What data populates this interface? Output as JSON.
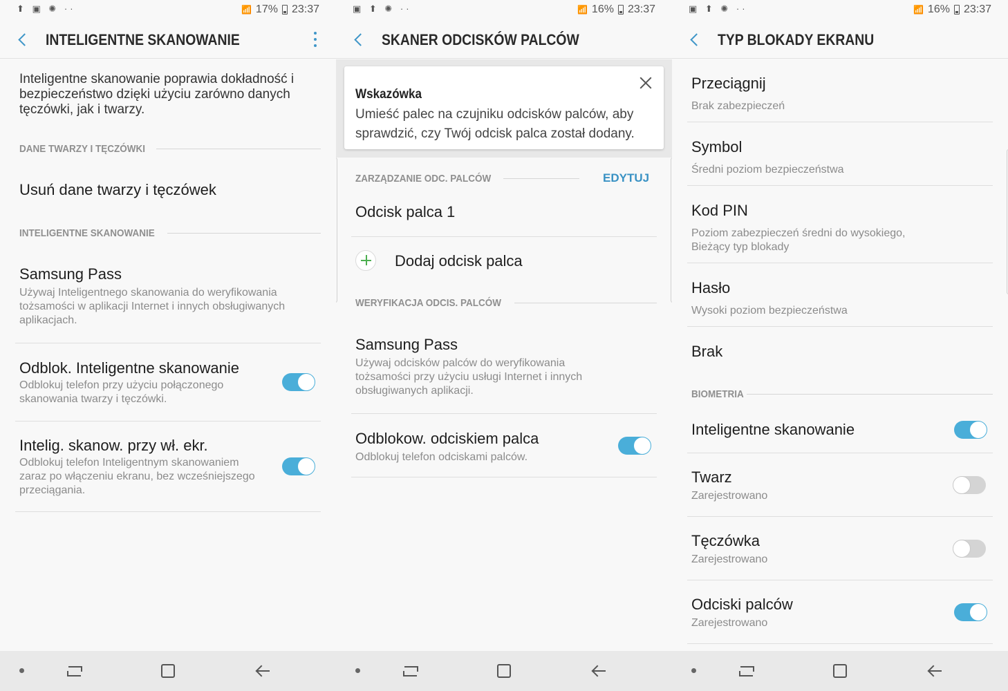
{
  "colors": {
    "accent": "#4aaed9",
    "link": "#3a92c4",
    "plus": "#4caf50"
  },
  "panel1": {
    "status": {
      "icons": "⬆ ▣ ✺ ··",
      "battery": "17%",
      "time": "23:37"
    },
    "title": "INTELIGENTNE SKANOWANIE",
    "description": "Inteligentne skanowanie poprawia dokładność i bezpieczeństwo dzięki użyciu zarówno danych tęczówki, jak i twarzy.",
    "section1": "DANE TWARZY I TĘCZÓWKI",
    "remove_data": "Usuń dane twarzy i tęczówek",
    "section2": "INTELIGENTNE SKANOWANIE",
    "samsung_pass": {
      "title": "Samsung Pass",
      "subtitle": "Używaj Inteligentnego skanowania do weryfikowania tożsamości w aplikacji Internet i innych obsługiwanych aplikacjach."
    },
    "unlock": {
      "title": "Odblok. Inteligentne skanowanie",
      "subtitle": "Odblokuj telefon przy użyciu połączonego skanowania twarzy i tęczówki.",
      "on": true
    },
    "screen_on": {
      "title": "Intelig. skanow. przy wł. ekr.",
      "subtitle": "Odblokuj telefon Inteligentnym skanowaniem zaraz po włączeniu ekranu, bez wcześniejszego przeciągania.",
      "on": true
    }
  },
  "panel2": {
    "status": {
      "icons": "▣ ⬆ ✺ ··",
      "battery": "16%",
      "time": "23:37"
    },
    "title": "SKANER ODCISKÓW PALCÓW",
    "tip": {
      "title": "Wskazówka",
      "body": "Umieść palec na czujniku odcisków palców, aby sprawdzić, czy Twój odcisk palca został dodany."
    },
    "section1": "ZARZĄDZANIE ODC. PALCÓW",
    "edit": "EDYTUJ",
    "fingerprint1": "Odcisk palca 1",
    "add_fingerprint": "Dodaj odcisk palca",
    "section2": "WERYFIKACJA ODCIS. PALCÓW",
    "samsung_pass": {
      "title": "Samsung Pass",
      "subtitle": "Używaj odcisków palców do weryfikowania tożsamości przy użyciu usługi Internet i innych obsługiwanych aplikacji."
    },
    "unlock": {
      "title": "Odblokow. odciskiem palca",
      "subtitle": "Odblokuj telefon odciskami palców.",
      "on": true
    }
  },
  "panel3": {
    "status": {
      "icons": "▣ ⬆ ✺ ··",
      "battery": "16%",
      "time": "23:37"
    },
    "title": "TYP BLOKADY EKRANU",
    "options": [
      {
        "title": "Przeciągnij",
        "subtitle": "Brak zabezpieczeń"
      },
      {
        "title": "Symbol",
        "subtitle": "Średni poziom bezpieczeństwa"
      },
      {
        "title": "Kod PIN",
        "subtitle": "Poziom zabezpieczeń średni do wysokiego,",
        "subtitle2": "Bieżący typ blokady"
      },
      {
        "title": "Hasło",
        "subtitle": "Wysoki poziom bezpieczeństwa"
      },
      {
        "title": "Brak"
      }
    ],
    "section": "BIOMETRIA",
    "biometrics": [
      {
        "title": "Inteligentne skanowanie",
        "on": true
      },
      {
        "title": "Twarz",
        "subtitle": "Zarejestrowano",
        "on": false
      },
      {
        "title": "Tęczówka",
        "subtitle": "Zarejestrowano",
        "on": false
      },
      {
        "title": "Odciski palców",
        "subtitle": "Zarejestrowano",
        "on": true
      }
    ]
  }
}
